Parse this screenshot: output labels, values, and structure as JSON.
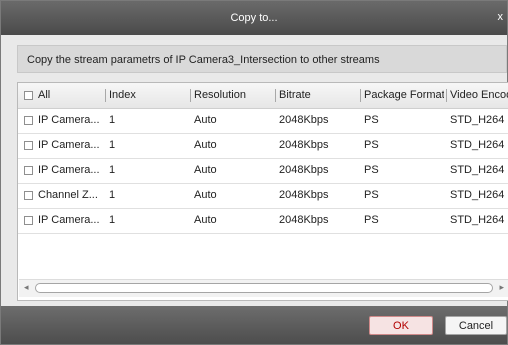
{
  "dialog": {
    "title": "Copy to...",
    "close_icon": "x",
    "description": "Copy the stream parametrs of IP Camera3_Intersection to other streams"
  },
  "table": {
    "columns": [
      "All",
      "Index",
      "Resolution",
      "Bitrate",
      "Package Format",
      "Video Encod"
    ],
    "rows": [
      [
        "IP Camera...",
        "1",
        "Auto",
        "2048Kbps",
        "PS",
        "STD_H264"
      ],
      [
        "IP Camera...",
        "1",
        "Auto",
        "2048Kbps",
        "PS",
        "STD_H264"
      ],
      [
        "IP Camera...",
        "1",
        "Auto",
        "2048Kbps",
        "PS",
        "STD_H264"
      ],
      [
        "Channel Z...",
        "1",
        "Auto",
        "2048Kbps",
        "PS",
        "STD_H264"
      ],
      [
        "IP Camera...",
        "1",
        "Auto",
        "2048Kbps",
        "PS",
        "STD_H264"
      ]
    ]
  },
  "scrollbar": {
    "left_arrow": "◂",
    "right_arrow": "▸"
  },
  "buttons": {
    "ok": "OK",
    "cancel": "Cancel"
  }
}
